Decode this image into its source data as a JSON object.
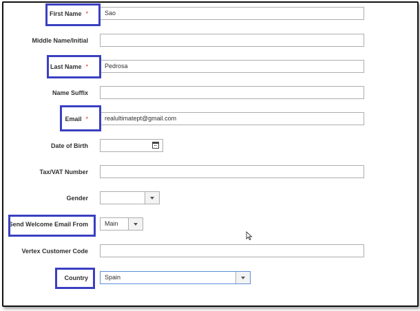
{
  "form": {
    "first_name": {
      "label": "First Name",
      "required_mark": "*",
      "value": "Sao"
    },
    "middle_name": {
      "label": "Middle Name/Initial",
      "value": ""
    },
    "last_name": {
      "label": "Last Name",
      "required_mark": "*",
      "value": "Pedrosa"
    },
    "name_suffix": {
      "label": "Name Suffix",
      "value": ""
    },
    "email": {
      "label": "Email",
      "required_mark": "*",
      "value": "realultimatept@gmail.com"
    },
    "dob": {
      "label": "Date of Birth",
      "value": "",
      "icon": "calendar-icon"
    },
    "taxvat": {
      "label": "Tax/VAT Number",
      "value": ""
    },
    "gender": {
      "label": "Gender",
      "value": ""
    },
    "send_welcome": {
      "label": "Send Welcome Email From",
      "value": "Main"
    },
    "vertex_code": {
      "label": "Vertex Customer Code",
      "value": ""
    },
    "country": {
      "label": "Country",
      "value": "Spain"
    }
  },
  "colors": {
    "highlight": "#3a3fc1",
    "required": "#e22626",
    "country_border": "#5b8dd6"
  }
}
